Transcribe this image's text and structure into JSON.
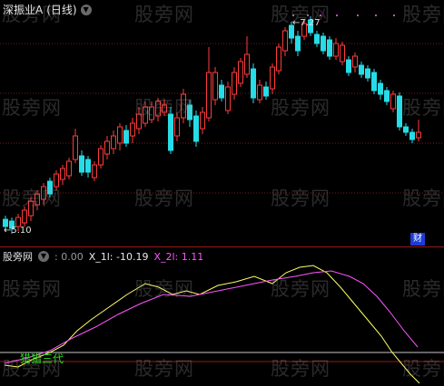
{
  "main": {
    "title": "深振业A",
    "period": "(日线)",
    "high_label": "7.27",
    "low_label": "5.10",
    "badge": "财",
    "watermark": "股旁网"
  },
  "indicator": {
    "name": "股旁网",
    "value_main": ": 0.00",
    "x1": "X_1l: -10.19",
    "x2": "X_2l: 1.11",
    "label": "猎猎三代"
  },
  "colors": {
    "up": "#ff3b3b",
    "down": "#26dce6",
    "line1": "#ffff66",
    "line2": "#ff55ff"
  }
}
